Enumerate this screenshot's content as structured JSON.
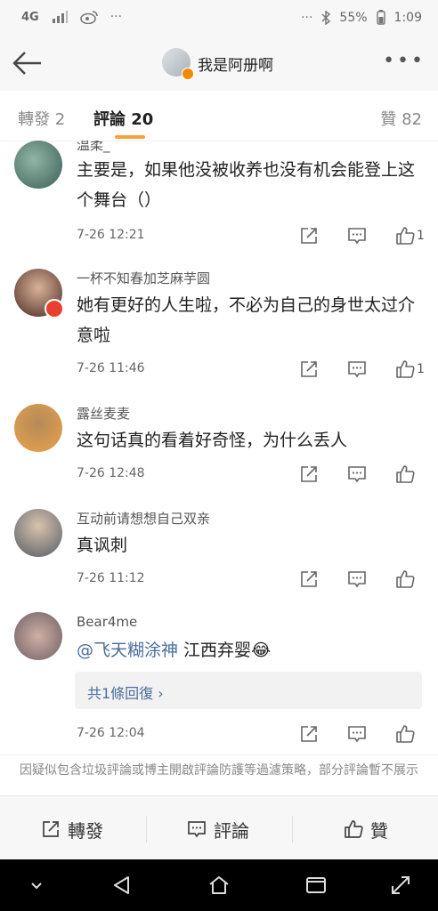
{
  "status_bar": {
    "carrier": "4G",
    "battery": "55%",
    "time": "1:09"
  },
  "header": {
    "title": "我是阿册啊"
  },
  "tabs": {
    "repost": "轉發 2",
    "comments": "評論 20",
    "likes": "贊 82"
  },
  "comments": [
    {
      "name": "温柔_",
      "text": "主要是，如果他没被收养也没有机会能登上这个舞台（）",
      "time": "7-26 12:21",
      "likes": "1"
    },
    {
      "name": "一杯不知春加芝麻芋圆",
      "text": "她有更好的人生啦，不必为自己的身世太过介意啦",
      "time": "7-26 11:46",
      "likes": "1"
    },
    {
      "name": "露丝麦麦",
      "text": "这句话真的看着好奇怪，为什么丢人",
      "time": "7-26 12:48",
      "likes": ""
    },
    {
      "name": "互动前请想想自己双亲",
      "text": "真讽刺",
      "time": "7-26 11:12",
      "likes": ""
    },
    {
      "name": "Bear4me",
      "mention": "@飞天糊涂神",
      "text": " 江西弃婴😂",
      "time": "7-26 12:04",
      "likes": "",
      "reply_link": "共1條回復 ›"
    }
  ],
  "notice": "因疑似包含垃圾評論或博主開啟評論防護等過濾策略，部分評論暫不展示",
  "bottom_bar": {
    "repost": "轉發",
    "comment": "評論",
    "like": "贊"
  }
}
